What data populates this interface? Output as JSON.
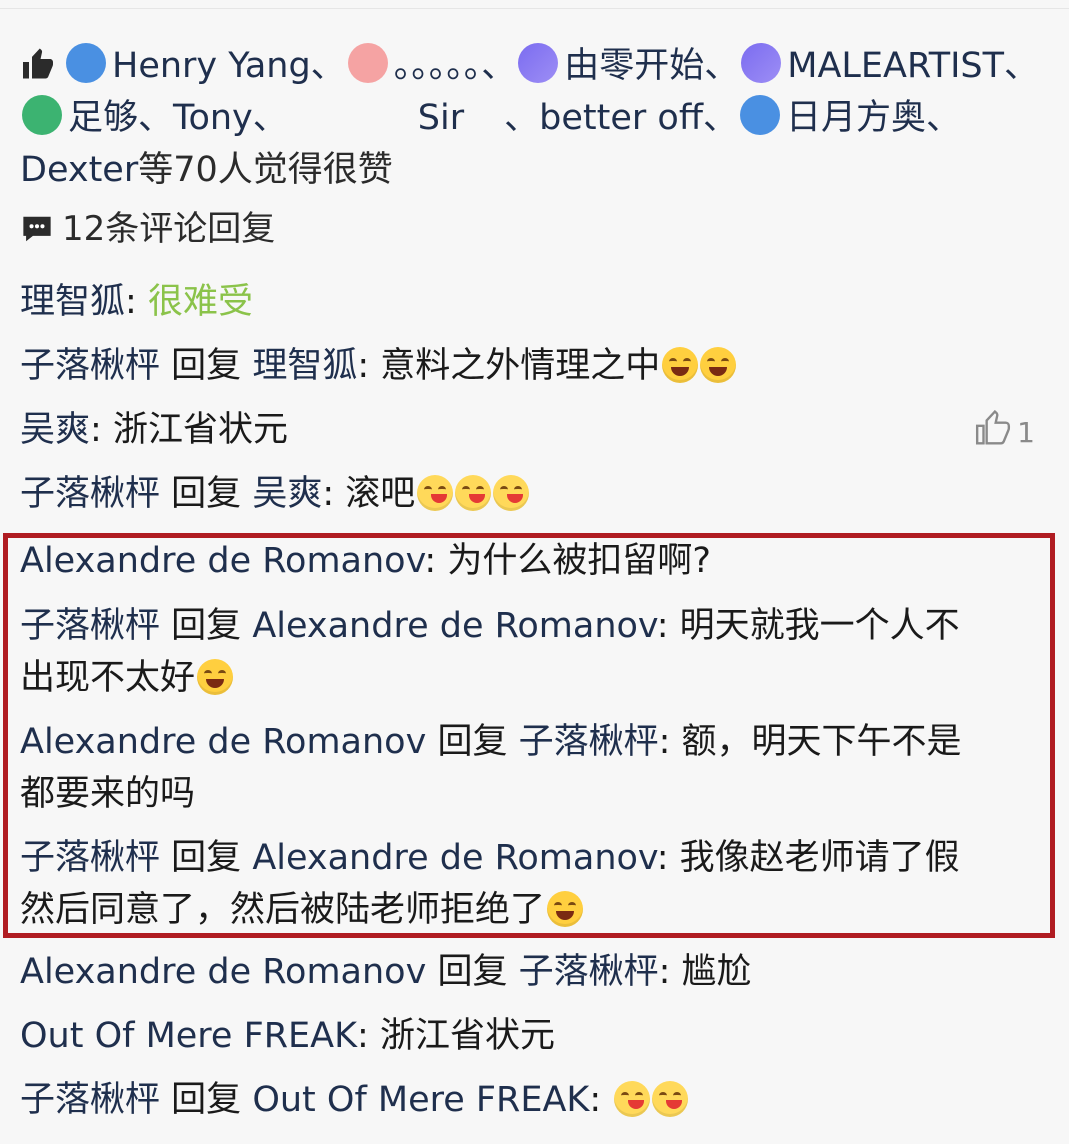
{
  "likes": {
    "names": [
      "Henry Yang",
      "。。。。。",
      "由零开始",
      "MALEARTIST",
      "足够",
      "Tony",
      "Sir",
      "better off",
      "日月方奥",
      "Dexter"
    ],
    "suffix": "等70人觉得很赞",
    "separator": "、"
  },
  "comments_header": {
    "label": "12条评论回复"
  },
  "comments": [
    {
      "user": "理智狐",
      "text": "很难受"
    },
    {
      "user": "子落楸枰",
      "reply_word": "回复",
      "reply_to": "理智狐",
      "text": "意料之外情理之中"
    },
    {
      "user": "吴爽",
      "text": "浙江省状元",
      "likes": "1"
    },
    {
      "user": "子落楸枰",
      "reply_word": "回复",
      "reply_to": "吴爽",
      "text": "滚吧"
    },
    {
      "user": "Alexandre de Romanov",
      "text": "为什么被扣留啊?"
    },
    {
      "user": "子落楸枰",
      "reply_word": "回复",
      "reply_to": "Alexandre de Romanov",
      "text_line1": "明天就我一个人不",
      "text_line2": "出现不太好"
    },
    {
      "user": "Alexandre de Romanov",
      "reply_word": "回复",
      "reply_to": "子落楸枰",
      "text_line1": "额，明天下午不是",
      "text_line2": "都要来的吗"
    },
    {
      "user": "子落楸枰",
      "reply_word": "回复",
      "reply_to": "Alexandre de Romanov",
      "text_line1": "我像赵老师请了假",
      "text_line2": "然后同意了，然后被陆老师拒绝了"
    },
    {
      "user": "Alexandre de Romanov",
      "reply_word": "回复",
      "reply_to": "子落楸枰",
      "text": "尴尬"
    },
    {
      "user": "Out Of Mere FREAK",
      "text": "浙江省状元"
    },
    {
      "user": "子落楸枰",
      "reply_word": "回复",
      "reply_to": "Out Of Mere FREAK",
      "text": ""
    }
  ],
  "colors": {
    "username": "#1f2f4d",
    "highlight_border": "#b01c22",
    "green_text": "#8bc34a"
  }
}
